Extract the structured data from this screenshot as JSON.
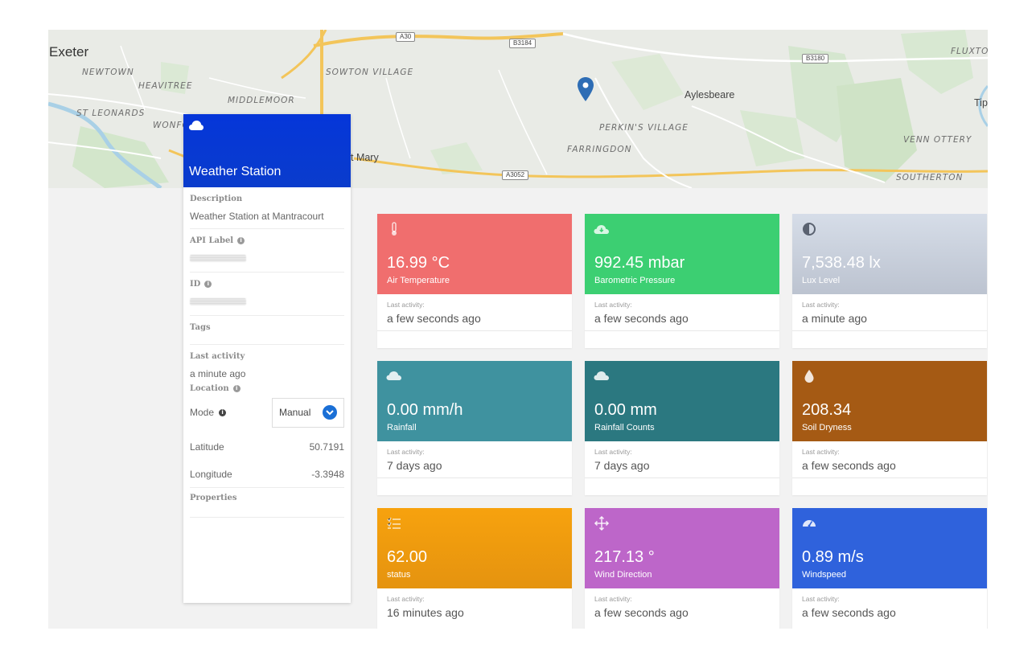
{
  "map": {
    "city": "Exeter",
    "town_labels": [
      "Aylesbeare",
      "t Mary",
      "Tip"
    ],
    "district_labels": [
      "NEWTOWN",
      "HEAVITREE",
      "ST LEONARDS",
      "WONFO",
      "MIDDLEMOOR",
      "SOWTON VILLAGE",
      "PERKIN'S VILLAGE",
      "FARRINGDON",
      "VENN OTTERY",
      "SOUTHERTON",
      "FLUXTON"
    ],
    "road_labels": [
      "A30",
      "B3184",
      "B3180",
      "A3052"
    ],
    "marker_icon": "map-marker-icon"
  },
  "device": {
    "icon": "cloud-icon",
    "title": "Weather Station",
    "description_label": "Description",
    "description_value": "Weather Station at Mantracourt",
    "api_label_label": "API Label",
    "id_label": "ID",
    "tags_label": "Tags",
    "last_activity_label": "Last activity",
    "last_activity_value": "a minute ago",
    "location_label": "Location",
    "mode_label": "Mode",
    "mode_value": "Manual",
    "latitude_label": "Latitude",
    "latitude_value": "50.7191",
    "longitude_label": "Longitude",
    "longitude_value": "-3.3948",
    "properties_label": "Properties",
    "colors": {
      "header": "#0536d9",
      "select_chevron": "#1a6fd6"
    }
  },
  "last_activity_prefix": "Last activity:",
  "cards": [
    {
      "value": "16.99 °C",
      "label": "Air Temperature",
      "last": "a few seconds ago",
      "icon": "thermometer-icon",
      "color": "#f06e6e"
    },
    {
      "value": "992.45 mbar",
      "label": "Barometric Pressure",
      "last": "a few seconds ago",
      "icon": "cloud-download-icon",
      "color": "#3ccf72"
    },
    {
      "value": "7,538.48 lx",
      "label": "Lux Level",
      "last": "a minute ago",
      "icon": "contrast-icon",
      "color": "#c4cad6"
    },
    {
      "value": "0.00 mm/h",
      "label": "Rainfall",
      "last": "7 days ago",
      "icon": "cloud-icon",
      "color": "#3f929f"
    },
    {
      "value": "0.00 mm",
      "label": "Rainfall Counts",
      "last": "7 days ago",
      "icon": "cloud-icon",
      "color": "#2b7880"
    },
    {
      "value": "208.34",
      "label": "Soil Dryness",
      "last": "a few seconds ago",
      "icon": "droplet-icon",
      "color": "#a55a14"
    },
    {
      "value": "62.00",
      "label": "status",
      "last": "16 minutes ago",
      "icon": "list-icon",
      "color": "#f5a114"
    },
    {
      "value": "217.13 °",
      "label": "Wind Direction",
      "last": "a few seconds ago",
      "icon": "arrows-icon",
      "color": "#bd66c9"
    },
    {
      "value": "0.89 m/s",
      "label": "Windspeed",
      "last": "a few seconds ago",
      "icon": "gauge-icon",
      "color": "#2f62dc"
    }
  ]
}
